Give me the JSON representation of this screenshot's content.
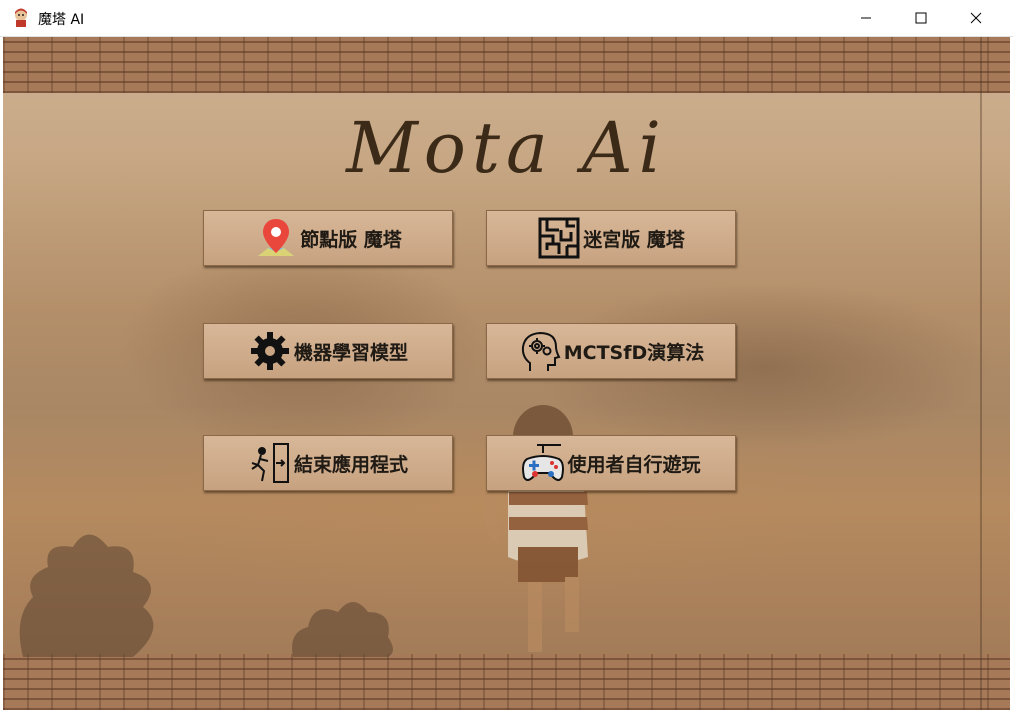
{
  "window": {
    "title": "魔塔 AI"
  },
  "app": {
    "logo_text": "Mota Ai"
  },
  "buttons": [
    {
      "label": "節點版 魔塔",
      "icon": "map-pin-icon"
    },
    {
      "label": "迷宮版 魔塔",
      "icon": "maze-icon"
    },
    {
      "label": "機器學習模型",
      "icon": "gear-icon"
    },
    {
      "label": "MCTSfD演算法",
      "icon": "brain-gear-icon"
    },
    {
      "label": "結束應用程式",
      "icon": "exit-door-icon"
    },
    {
      "label": "使用者自行遊玩",
      "icon": "gamepad-icon"
    }
  ],
  "colors": {
    "button_bg": "#d2b08f",
    "button_text": "#1f1a14",
    "logo": "#3b2a17",
    "background": "#b48f6a"
  }
}
